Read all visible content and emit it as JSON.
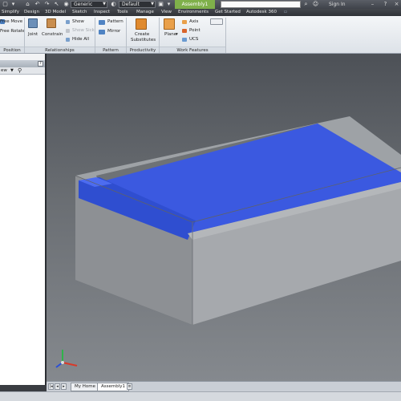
{
  "quick_access": {
    "appearance_value": "Generic",
    "display_value": "Default",
    "document_title": "Assembly1",
    "sign_in": "Sign In"
  },
  "menu_tabs": [
    "Simplify",
    "Design",
    "3D Model",
    "Sketch",
    "Inspect",
    "Tools",
    "Manage",
    "View",
    "Environments",
    "Get Started",
    "Autodesk 360"
  ],
  "ribbon": {
    "position": {
      "free_move": "Free Move",
      "free_rotate": "Free Rotate",
      "label": "Position"
    },
    "relationships": {
      "joint": "Joint",
      "constrain": "Constrain",
      "show": "Show",
      "show_sick": "Show Sick",
      "hide_all": "Hide All",
      "label": "Relationships"
    },
    "pattern": {
      "pattern": "Pattern",
      "mirror": "Mirror",
      "label": "Pattern"
    },
    "productivity": {
      "create_line1": "Create",
      "create_line2": "Substitutes",
      "label": "Productivity"
    },
    "work_features": {
      "plane": "Plane",
      "axis": "Axis",
      "point": "Point",
      "ucs": "UCS",
      "label": "Work Features"
    }
  },
  "browser": {
    "view_label": "ew"
  },
  "doc_tabs": [
    "My Home",
    "Assembly1"
  ],
  "colors": {
    "accent_green": "#7fb04a",
    "model_blue": "#3d5ee0",
    "box_gray": "#8a8d91"
  },
  "icons": {
    "binoculars": "binoculars-icon",
    "triad": "coordinate-triad-icon"
  }
}
